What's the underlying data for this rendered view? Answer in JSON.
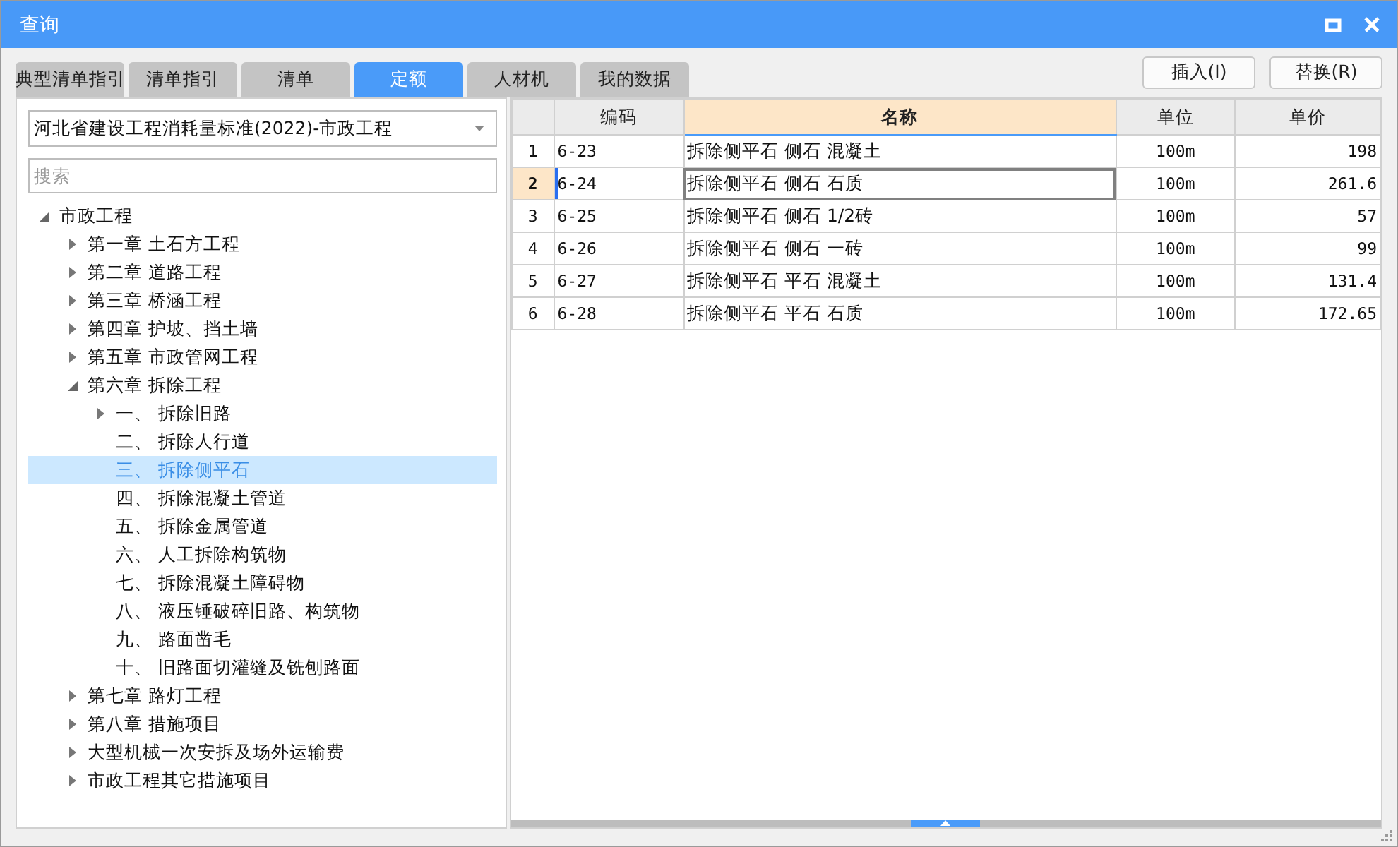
{
  "window": {
    "title": "查询"
  },
  "tabs": [
    {
      "label": "典型清单指引",
      "selected": false
    },
    {
      "label": "清单指引",
      "selected": false
    },
    {
      "label": "清单",
      "selected": false
    },
    {
      "label": "定额",
      "selected": true
    },
    {
      "label": "人材机",
      "selected": false
    },
    {
      "label": "我的数据",
      "selected": false
    }
  ],
  "buttons": [
    "插入(I)",
    "替换(R)"
  ],
  "library": {
    "value": "河北省建设工程消耗量标准(2022)-市政工程"
  },
  "search": {
    "placeholder": "搜索"
  },
  "tree": [
    {
      "label": "市政工程",
      "kind": "folder",
      "expanded": true,
      "selected": false,
      "children": [
        {
          "label": "第一章 土石方工程",
          "kind": "folder",
          "expanded": false,
          "selected": false
        },
        {
          "label": "第二章 道路工程",
          "kind": "folder",
          "expanded": false,
          "selected": false
        },
        {
          "label": "第三章 桥涵工程",
          "kind": "folder",
          "expanded": false,
          "selected": false
        },
        {
          "label": "第四章 护坡、挡土墙",
          "kind": "folder",
          "expanded": false,
          "selected": false
        },
        {
          "label": "第五章 市政管网工程",
          "kind": "folder",
          "expanded": false,
          "selected": false
        },
        {
          "label": "第六章 拆除工程",
          "kind": "folder",
          "expanded": true,
          "selected": false,
          "children": [
            {
              "label": "一、 拆除旧路",
              "kind": "folder",
              "expanded": false,
              "selected": false
            },
            {
              "label": "二、 拆除人行道",
              "kind": "leaf",
              "expanded": false,
              "selected": false
            },
            {
              "label": "三、 拆除侧平石",
              "kind": "leaf",
              "expanded": false,
              "selected": true
            },
            {
              "label": "四、 拆除混凝土管道",
              "kind": "leaf",
              "expanded": false,
              "selected": false
            },
            {
              "label": "五、 拆除金属管道",
              "kind": "leaf",
              "expanded": false,
              "selected": false
            },
            {
              "label": "六、 人工拆除构筑物",
              "kind": "leaf",
              "expanded": false,
              "selected": false
            },
            {
              "label": "七、 拆除混凝土障碍物",
              "kind": "leaf",
              "expanded": false,
              "selected": false
            },
            {
              "label": "八、 液压锤破碎旧路、构筑物",
              "kind": "leaf",
              "expanded": false,
              "selected": false
            },
            {
              "label": "九、 路面凿毛",
              "kind": "leaf",
              "expanded": false,
              "selected": false
            },
            {
              "label": "十、 旧路面切灌缝及铣刨路面",
              "kind": "leaf",
              "expanded": false,
              "selected": false
            }
          ]
        },
        {
          "label": "第七章 路灯工程",
          "kind": "folder",
          "expanded": false,
          "selected": false
        },
        {
          "label": "第八章 措施项目",
          "kind": "folder",
          "expanded": false,
          "selected": false
        },
        {
          "label": "大型机械一次安拆及场外运输费",
          "kind": "folder",
          "expanded": false,
          "selected": false
        },
        {
          "label": "市政工程其它措施项目",
          "kind": "folder",
          "expanded": false,
          "selected": false
        }
      ]
    }
  ],
  "table": {
    "columns": [
      {
        "label": "编码",
        "selected": false
      },
      {
        "label": "名称",
        "selected": true
      },
      {
        "label": "单位",
        "selected": false
      },
      {
        "label": "单价",
        "selected": false
      }
    ],
    "rows": [
      {
        "index": "1",
        "cells": [
          "6-23",
          "拆除侧平石 侧石 混凝土",
          "100m",
          "198"
        ],
        "selected": false
      },
      {
        "index": "2",
        "cells": [
          "6-24",
          "拆除侧平石 侧石 石质",
          "100m",
          "261.6"
        ],
        "selected": true
      },
      {
        "index": "3",
        "cells": [
          "6-25",
          "拆除侧平石 侧石 1/2砖",
          "100m",
          "57"
        ],
        "selected": false
      },
      {
        "index": "4",
        "cells": [
          "6-26",
          "拆除侧平石 侧石 一砖",
          "100m",
          "99"
        ],
        "selected": false
      },
      {
        "index": "5",
        "cells": [
          "6-27",
          "拆除侧平石 平石 混凝土",
          "100m",
          "131.4"
        ],
        "selected": false
      },
      {
        "index": "6",
        "cells": [
          "6-28",
          "拆除侧平石 平石 石质",
          "100m",
          "172.65"
        ],
        "selected": false
      }
    ]
  }
}
